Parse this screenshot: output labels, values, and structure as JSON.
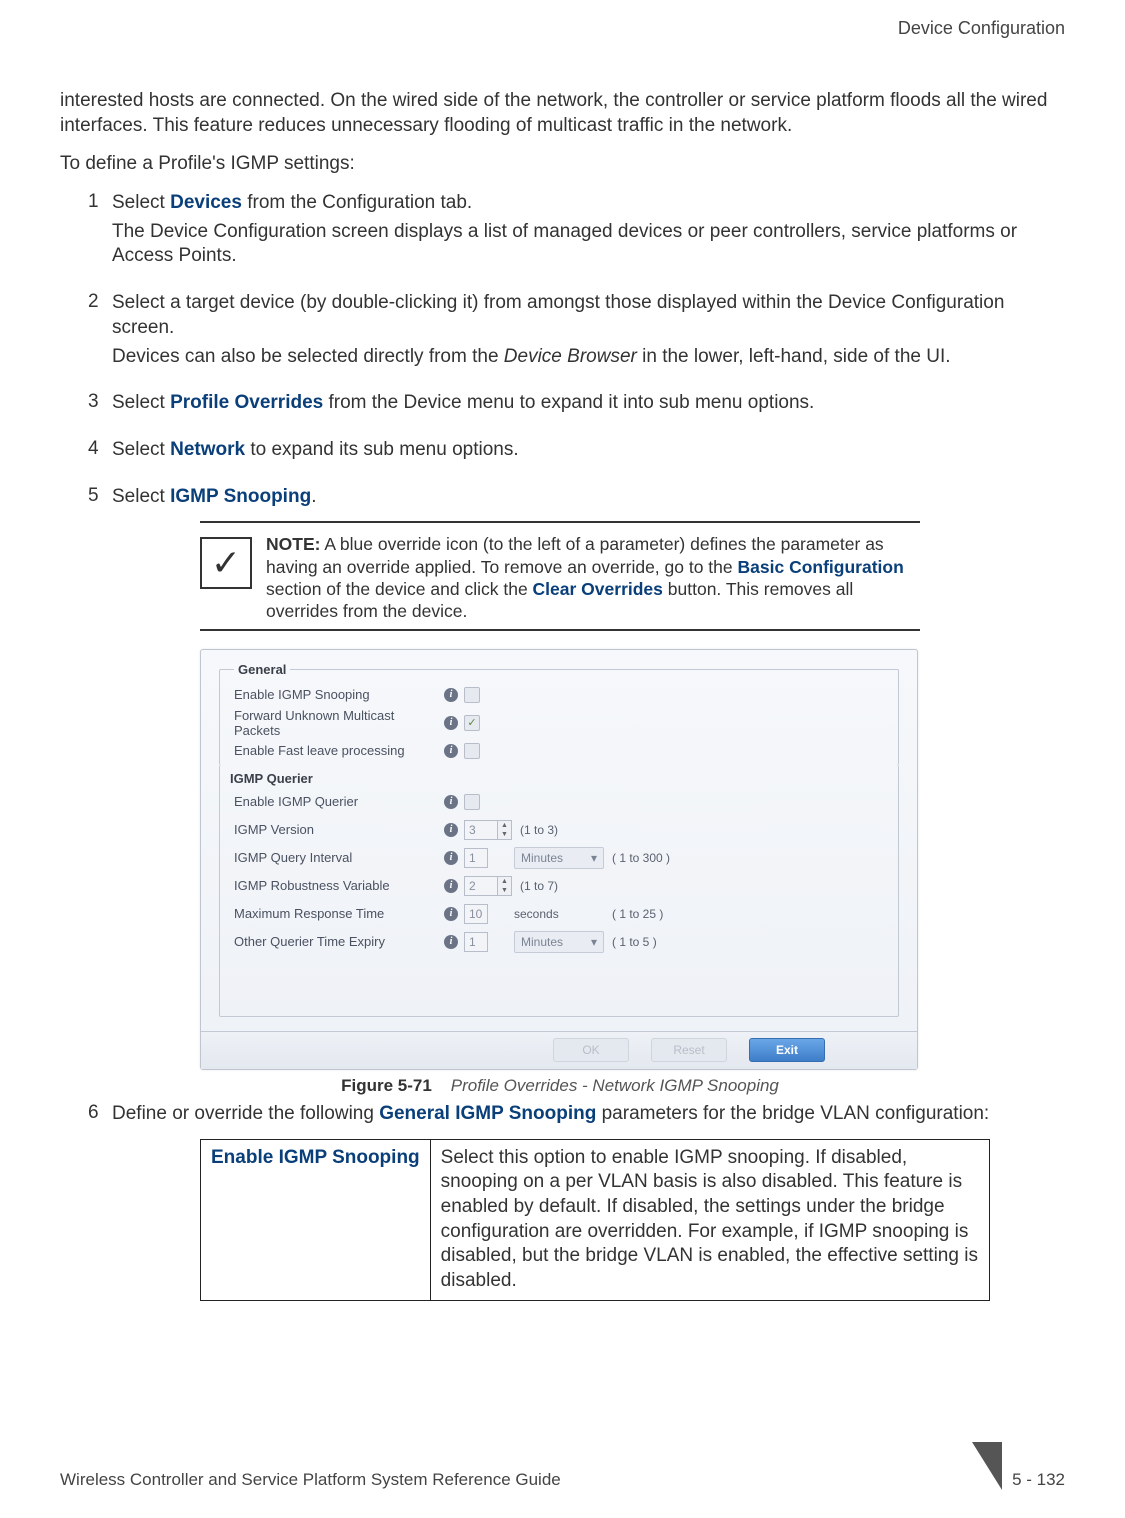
{
  "header": {
    "section": "Device Configuration"
  },
  "intro1": "interested hosts are connected. On the wired side of the network, the controller or service platform floods all the wired interfaces. This feature reduces unnecessary flooding of multicast traffic in the network.",
  "intro2": "To define a Profile's IGMP settings:",
  "steps": {
    "s1_a": "Select ",
    "s1_bold": "Devices",
    "s1_b": " from the Configuration tab.",
    "s1_sub": "The Device Configuration screen displays a list of managed devices or peer controllers, service platforms or Access Points.",
    "s2_a": "Select a target device (by double-clicking it) from amongst those displayed within the Device Configuration screen.",
    "s2_sub_a": "Devices can also be selected directly from the ",
    "s2_sub_i": "Device Browser",
    "s2_sub_b": " in the lower, left-hand, side of the UI.",
    "s3_a": "Select ",
    "s3_bold": "Profile Overrides",
    "s3_b": " from the Device menu to expand it into sub menu options.",
    "s4_a": "Select ",
    "s4_bold": "Network",
    "s4_b": " to expand its sub menu options.",
    "s5_a": "Select ",
    "s5_bold": "IGMP Snooping",
    "s5_b": ".",
    "s6_a": "Define or override the following ",
    "s6_bold": "General IGMP Snooping",
    "s6_b": " parameters for the bridge VLAN configuration:"
  },
  "note": {
    "lead": "NOTE:",
    "t1": " A blue override icon (to the left of a parameter) defines the parameter as having an override applied. To remove an override, go to the ",
    "b1": "Basic Configuration",
    "t2": " section of the device and click the ",
    "b2": "Clear Overrides",
    "t3": " button. This removes all overrides from the device."
  },
  "panel": {
    "group_general": "General",
    "enable_igmp_snooping": "Enable IGMP Snooping",
    "forward_unknown": "Forward Unknown Multicast Packets",
    "enable_fast_leave": "Enable Fast leave processing",
    "group_querier": "IGMP Querier",
    "enable_querier": "Enable IGMP Querier",
    "igmp_version": "IGMP Version",
    "igmp_version_val": "3",
    "igmp_version_range": "(1 to 3)",
    "query_interval": "IGMP Query Interval",
    "query_interval_val": "1",
    "query_interval_unit": "Minutes",
    "query_interval_range": "( 1 to 300 )",
    "robustness": "IGMP Robustness Variable",
    "robustness_val": "2",
    "robustness_range": "(1 to 7)",
    "max_resp": "Maximum Response Time",
    "max_resp_val": "10",
    "max_resp_unit": "seconds",
    "max_resp_range": "( 1 to 25 )",
    "other_expiry": "Other Querier Time Expiry",
    "other_expiry_val": "1",
    "other_expiry_unit": "Minutes",
    "other_expiry_range": "( 1 to 5 )",
    "btn_ok": "OK",
    "btn_reset": "Reset",
    "btn_exit": "Exit"
  },
  "figure": {
    "num": "Figure 5-71",
    "caption": "Profile Overrides - Network IGMP Snooping"
  },
  "table": {
    "name": "Enable IGMP Snooping",
    "desc": "Select this option to enable IGMP snooping. If disabled, snooping on a per VLAN basis is also disabled. This feature is enabled by default. If disabled, the settings under the bridge configuration are overridden. For example, if IGMP snooping is disabled, but the bridge VLAN is enabled, the effective setting is disabled."
  },
  "footer": {
    "doc": "Wireless Controller and Service Platform System Reference Guide",
    "page": "5 - 132"
  }
}
